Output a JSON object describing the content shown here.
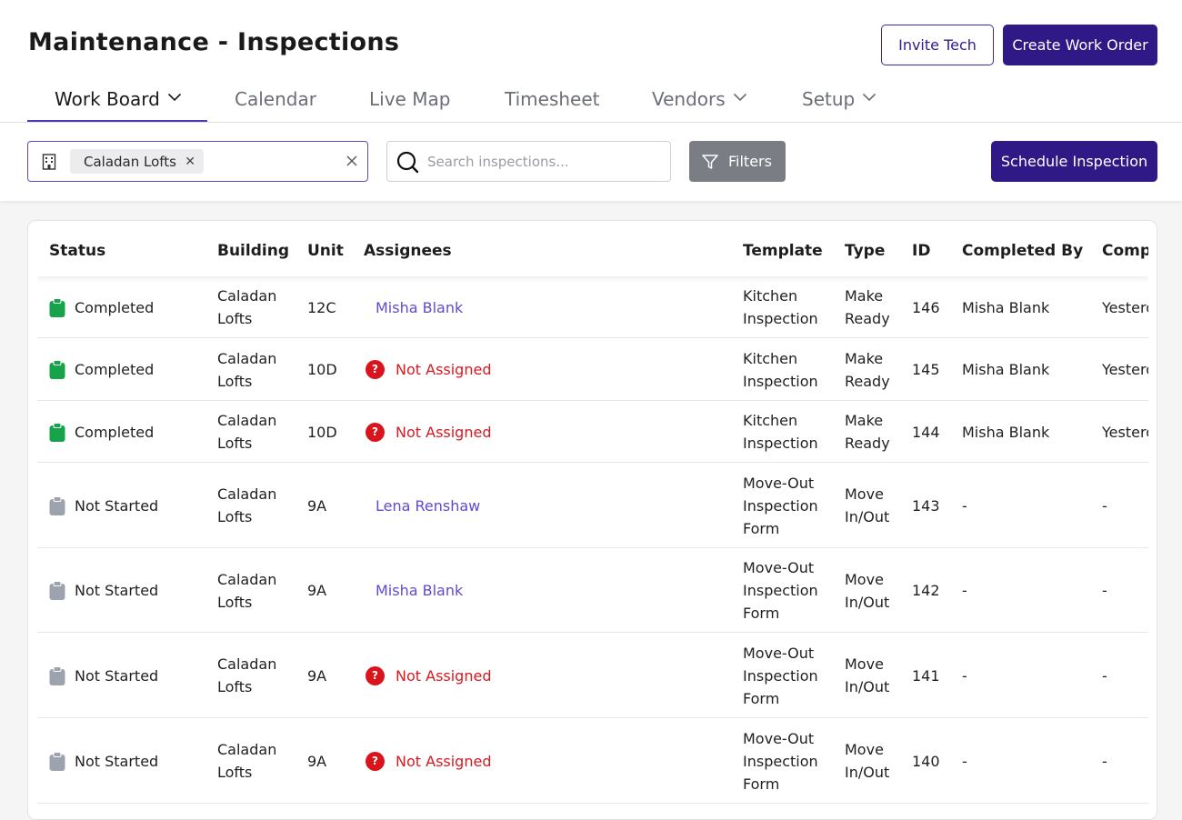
{
  "header": {
    "title": "Maintenance - Inspections",
    "invite_label": "Invite Tech",
    "create_label": "Create Work Order"
  },
  "tabs": [
    {
      "label": "Work Board",
      "active": true,
      "dropdown": true
    },
    {
      "label": "Calendar",
      "active": false,
      "dropdown": false
    },
    {
      "label": "Live Map",
      "active": false,
      "dropdown": false
    },
    {
      "label": "Timesheet",
      "active": false,
      "dropdown": false
    },
    {
      "label": "Vendors",
      "active": false,
      "dropdown": true
    },
    {
      "label": "Setup",
      "active": false,
      "dropdown": true
    }
  ],
  "toolbar": {
    "building_chip": "Caladan Lofts",
    "search_placeholder": "Search inspections...",
    "filters_label": "Filters",
    "schedule_label": "Schedule Inspection"
  },
  "colors": {
    "primary": "#2e1987",
    "completed": "#16a34a",
    "not_started": "#9ca3af",
    "link": "#5f4bd0",
    "error": "#d71920"
  },
  "table": {
    "columns": [
      "Status",
      "Building",
      "Unit",
      "Assignees",
      "Template",
      "Type",
      "ID",
      "Completed By",
      "Comp"
    ],
    "rows": [
      {
        "status": "Completed",
        "building": [
          "Caladan",
          "Lofts"
        ],
        "unit": "12C",
        "assignee": "Misha Blank",
        "assigned": true,
        "template": [
          "Kitchen",
          "Inspection"
        ],
        "type": [
          "Make",
          "Ready"
        ],
        "id": "146",
        "completed_by": "Misha Blank",
        "completed": "Yesterday"
      },
      {
        "status": "Completed",
        "building": [
          "Caladan",
          "Lofts"
        ],
        "unit": "10D",
        "assignee": "Not Assigned",
        "assigned": false,
        "template": [
          "Kitchen",
          "Inspection"
        ],
        "type": [
          "Make",
          "Ready"
        ],
        "id": "145",
        "completed_by": "Misha Blank",
        "completed": "Yesterday"
      },
      {
        "status": "Completed",
        "building": [
          "Caladan",
          "Lofts"
        ],
        "unit": "10D",
        "assignee": "Not Assigned",
        "assigned": false,
        "template": [
          "Kitchen",
          "Inspection"
        ],
        "type": [
          "Make",
          "Ready"
        ],
        "id": "144",
        "completed_by": "Misha Blank",
        "completed": "Yesterday"
      },
      {
        "status": "Not Started",
        "building": [
          "Caladan",
          "Lofts"
        ],
        "unit": "9A",
        "assignee": "Lena Renshaw",
        "assigned": true,
        "template": [
          "Move-Out",
          "Inspection",
          "Form"
        ],
        "type": [
          "Move",
          "In/Out"
        ],
        "id": "143",
        "completed_by": "-",
        "completed": "-"
      },
      {
        "status": "Not Started",
        "building": [
          "Caladan",
          "Lofts"
        ],
        "unit": "9A",
        "assignee": "Misha Blank",
        "assigned": true,
        "template": [
          "Move-Out",
          "Inspection",
          "Form"
        ],
        "type": [
          "Move",
          "In/Out"
        ],
        "id": "142",
        "completed_by": "-",
        "completed": "-"
      },
      {
        "status": "Not Started",
        "building": [
          "Caladan",
          "Lofts"
        ],
        "unit": "9A",
        "assignee": "Not Assigned",
        "assigned": false,
        "template": [
          "Move-Out",
          "Inspection",
          "Form"
        ],
        "type": [
          "Move",
          "In/Out"
        ],
        "id": "141",
        "completed_by": "-",
        "completed": "-"
      },
      {
        "status": "Not Started",
        "building": [
          "Caladan",
          "Lofts"
        ],
        "unit": "9A",
        "assignee": "Not Assigned",
        "assigned": false,
        "template": [
          "Move-Out",
          "Inspection",
          "Form"
        ],
        "type": [
          "Move",
          "In/Out"
        ],
        "id": "140",
        "completed_by": "-",
        "completed": "-"
      }
    ]
  }
}
